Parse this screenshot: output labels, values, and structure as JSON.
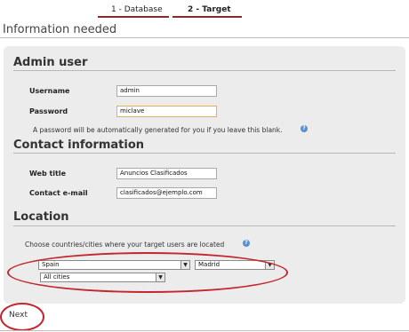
{
  "steps": [
    {
      "label": "1 - Database"
    },
    {
      "label": "2 - Target"
    }
  ],
  "page_title": "Information needed",
  "admin": {
    "title": "Admin user",
    "username_label": "Username",
    "username_value": "admin",
    "password_label": "Password",
    "password_value": "miclave",
    "password_hint": "A password will be automatically generated for you if you leave this blank."
  },
  "contact": {
    "title": "Contact information",
    "web_title_label": "Web title",
    "web_title_value": "Anuncios Clasificados",
    "email_label": "Contact e-mail",
    "email_value": "clasificados@ejemplo.com"
  },
  "location": {
    "title": "Location",
    "hint": "Choose countries/cities where your target users are located",
    "country_selected": "Spain",
    "region_selected": "Madrid",
    "city_selected": "All cities"
  },
  "next_label": "Next",
  "colors": {
    "accent": "#8a2b2b",
    "annotation": "#c1272d",
    "panel": "#ececec",
    "help_icon": "#5a8fd0"
  },
  "icons": {
    "help": "help-icon",
    "dropdown": "chevron-down-icon"
  }
}
